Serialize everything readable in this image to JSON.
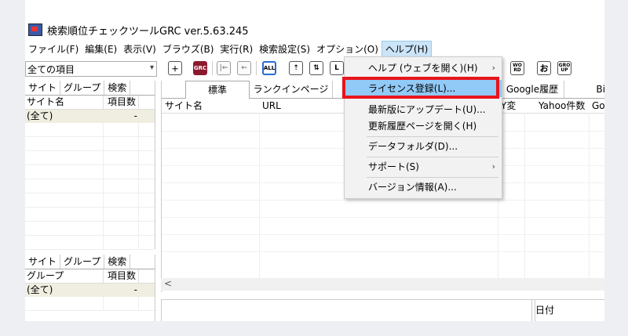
{
  "window": {
    "title": "検索順位チェックツールGRC  ver.5.63.245"
  },
  "menubar": [
    "ファイル(F)",
    "編集(E)",
    "表示(V)",
    "ブラウズ(B)",
    "実行(R)",
    "検索設定(S)",
    "オプション(O)",
    "ヘルプ(H)"
  ],
  "toolbar": {
    "combo_value": "全ての項目",
    "buttons": [
      "GRC",
      "ALL",
      "WO RD",
      "お",
      "GRO UP"
    ]
  },
  "left_top": {
    "tabs": [
      "サイト",
      "グループ",
      "検索"
    ],
    "headers": [
      "サイト名",
      "項目数"
    ],
    "row": [
      "(全て)",
      "-"
    ]
  },
  "left_bottom": {
    "tabs": [
      "サイト",
      "グループ",
      "検索"
    ],
    "headers": [
      "グループ",
      "項目数"
    ],
    "row": [
      "(全て)",
      "-"
    ]
  },
  "main": {
    "tabs": [
      "標準",
      "ランクインページ",
      "Google履歴",
      "Bin"
    ],
    "headers": [
      "サイト名",
      "URL",
      "Y変",
      "Yahoo件数",
      "Go"
    ],
    "date_header": "日付"
  },
  "help_menu": {
    "items": [
      {
        "label": "ヘルプ (ウェブを開く)(H)",
        "submenu": true
      },
      {
        "label": "ライセンス登録(L)...",
        "submenu": false
      },
      {
        "label": "最新版にアップデート(U)...",
        "submenu": false
      },
      {
        "label": "更新履歴ページを開く(H)",
        "submenu": false
      },
      {
        "label": "データフォルダ(D)...",
        "submenu": false
      },
      {
        "label": "サポート(S)",
        "submenu": true
      },
      {
        "label": "バージョン情報(A)...",
        "submenu": false
      }
    ]
  },
  "colors": {
    "highlight": "#91c9f7",
    "callout": "#e8141b"
  }
}
